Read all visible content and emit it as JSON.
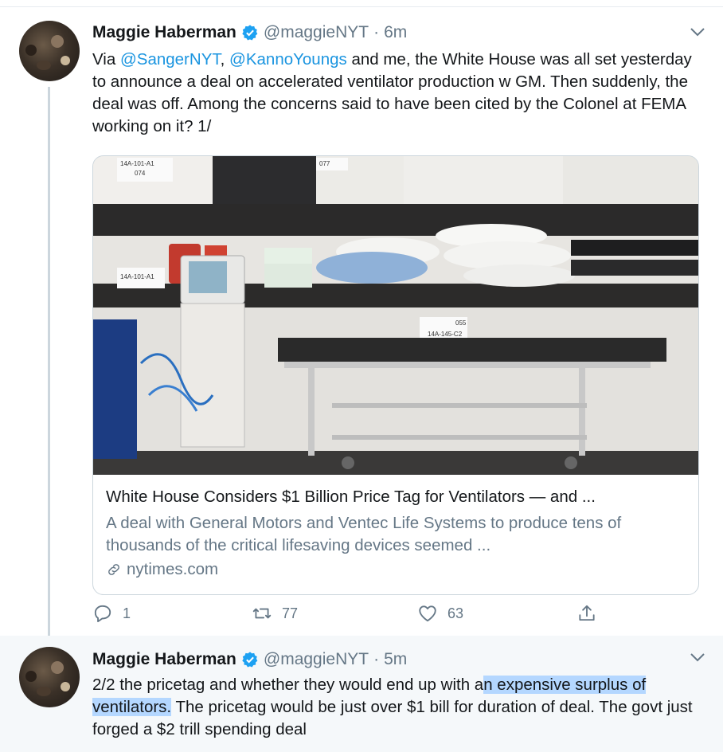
{
  "tweets": [
    {
      "name": "Maggie Haberman",
      "handle": "@maggieNYT",
      "time": "6m",
      "text_parts": {
        "t1": "Via ",
        "m1": "@SangerNYT",
        "t2": ", ",
        "m2": "@KannoYoungs",
        "t3": " and me, the White House was all set yesterday to announce a deal on accelerated ventilator production w GM. Then suddenly, the deal was off. Among the concerns said to have been cited by the Colonel at FEMA working on it? 1/"
      },
      "card": {
        "title": "White House Considers $1 Billion Price Tag for Ventilators — and ...",
        "description": "A deal with General Motors and Ventec Life Systems to produce tens of thousands of the critical lifesaving devices seemed ...",
        "domain": "nytimes.com",
        "image_labels": {
          "l1": "14A-101-A1",
          "l2": "074",
          "l3": "14A-101-A1",
          "l4": "14A-145-C2",
          "l5": "077",
          "l6": "055"
        }
      },
      "actions": {
        "reply_count": "1",
        "retweet_count": "77",
        "like_count": "63"
      }
    },
    {
      "name": "Maggie Haberman",
      "handle": "@maggieNYT",
      "time": "5m",
      "text_parts": {
        "t1": "2/2 the pricetag and whether they would end up with a",
        "hl": "n expensive surplus of ventilators.",
        "t2": " The pricetag would be just over $1 bill for duration of deal. The govt just forged a $2 trill spending deal"
      }
    }
  ],
  "colors": {
    "link": "#1b95e0",
    "secondary_text": "#657786",
    "verified": "#1da1f2",
    "highlight": "#b4d7ff"
  },
  "icons": [
    "verified-badge-icon",
    "chevron-down-icon",
    "reply-icon",
    "retweet-icon",
    "like-icon",
    "share-icon",
    "link-icon"
  ]
}
